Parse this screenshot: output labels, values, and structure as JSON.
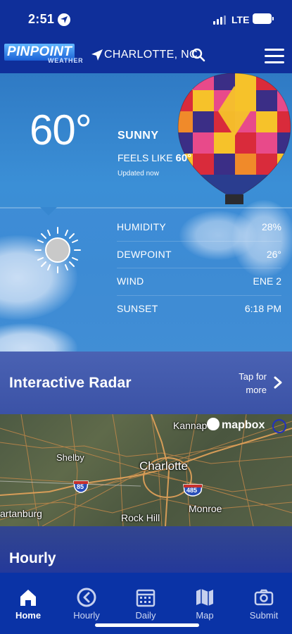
{
  "status_bar": {
    "time": "2:51",
    "network": "LTE"
  },
  "header": {
    "logo_line1": "PINPOINT",
    "logo_line2": "WEATHER",
    "location": "CHARLOTTE, NC"
  },
  "current": {
    "temperature": "60°",
    "condition": "SUNNY",
    "feels_like_label": "FEELS LIKE",
    "feels_like_value": "60°",
    "updated": "Updated now",
    "details": [
      {
        "label": "HUMIDITY",
        "value": "28%"
      },
      {
        "label": "DEWPOINT",
        "value": "26°"
      },
      {
        "label": "WIND",
        "value": "ENE 2"
      },
      {
        "label": "SUNSET",
        "value": "6:18 PM"
      }
    ]
  },
  "radar": {
    "title": "Interactive Radar",
    "tap_line1": "Tap for",
    "tap_line2": "more"
  },
  "map": {
    "attribution": "mapbox",
    "labels": {
      "kannapolis": "Kannap",
      "shelby": "Shelby",
      "charlotte": "Charlotte",
      "spartanburg": "artanburg",
      "rock_hill": "Rock Hill",
      "monroe": "Monroe"
    },
    "shields": {
      "i85": "85",
      "i485": "485"
    }
  },
  "hourly": {
    "title": "Hourly"
  },
  "tabs": [
    {
      "label": "Home",
      "icon": "house-icon",
      "active": true
    },
    {
      "label": "Hourly",
      "icon": "clock-back-icon",
      "active": false
    },
    {
      "label": "Daily",
      "icon": "calendar-icon",
      "active": false
    },
    {
      "label": "Map",
      "icon": "map-icon",
      "active": false
    },
    {
      "label": "Submit",
      "icon": "camera-icon",
      "active": false
    }
  ],
  "colors": {
    "brand_blue": "#0f2f9a",
    "tab_bar": "#0a33a6",
    "sky": "#3b8fd6"
  }
}
